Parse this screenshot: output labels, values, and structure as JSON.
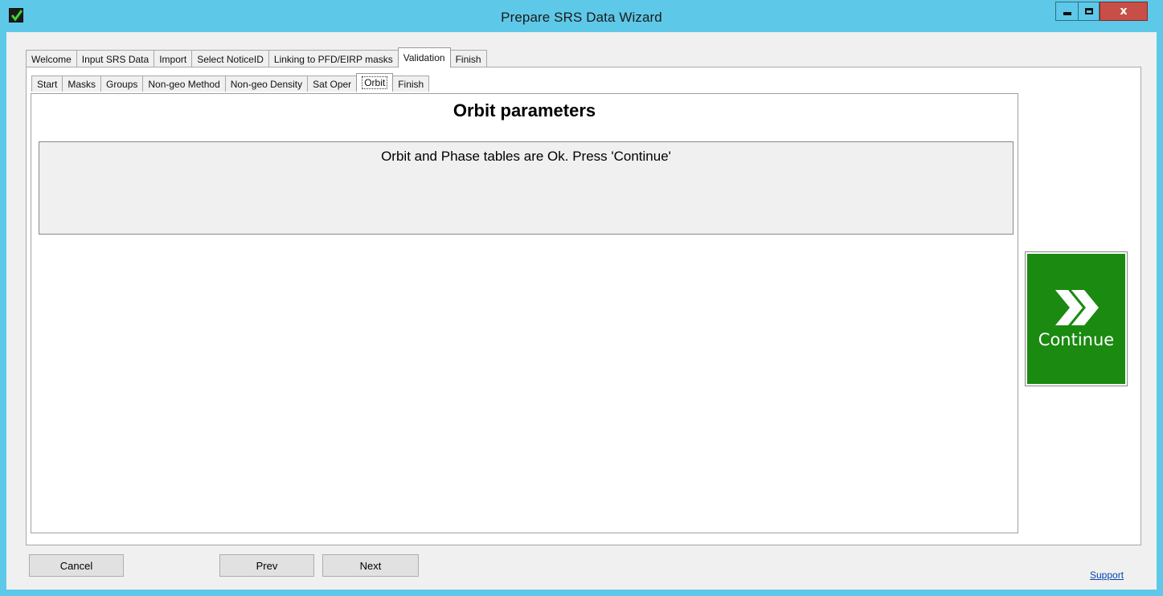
{
  "window": {
    "title": "Prepare SRS Data Wizard",
    "app_icon": "checkmark-icon",
    "controls": {
      "minimize": "minimize-icon",
      "maximize": "maximize-icon",
      "close": "x"
    }
  },
  "outer_tabs": [
    {
      "label": "Welcome",
      "active": false
    },
    {
      "label": "Input SRS Data",
      "active": false
    },
    {
      "label": "Import",
      "active": false
    },
    {
      "label": "Select NoticeID",
      "active": false
    },
    {
      "label": "Linking to PFD/EIRP masks",
      "active": false
    },
    {
      "label": "Validation",
      "active": true
    },
    {
      "label": "Finish",
      "active": false
    }
  ],
  "inner_tabs": [
    {
      "label": "Start",
      "active": false
    },
    {
      "label": "Masks",
      "active": false
    },
    {
      "label": "Groups",
      "active": false
    },
    {
      "label": "Non-geo Method",
      "active": false
    },
    {
      "label": "Non-geo Density",
      "active": false
    },
    {
      "label": "Sat Oper",
      "active": false
    },
    {
      "label": "Orbit",
      "active": true
    },
    {
      "label": "Finish",
      "active": false
    }
  ],
  "panel": {
    "heading": "Orbit parameters",
    "message": "Orbit and Phase tables are Ok. Press 'Continue'"
  },
  "continue_button": {
    "label": "Continue",
    "icon": "double-chevron-right-icon",
    "color": "#1a8a10"
  },
  "footer": {
    "cancel_label": "Cancel",
    "prev_label": "Prev",
    "next_label": "Next",
    "support_label": "Support"
  }
}
